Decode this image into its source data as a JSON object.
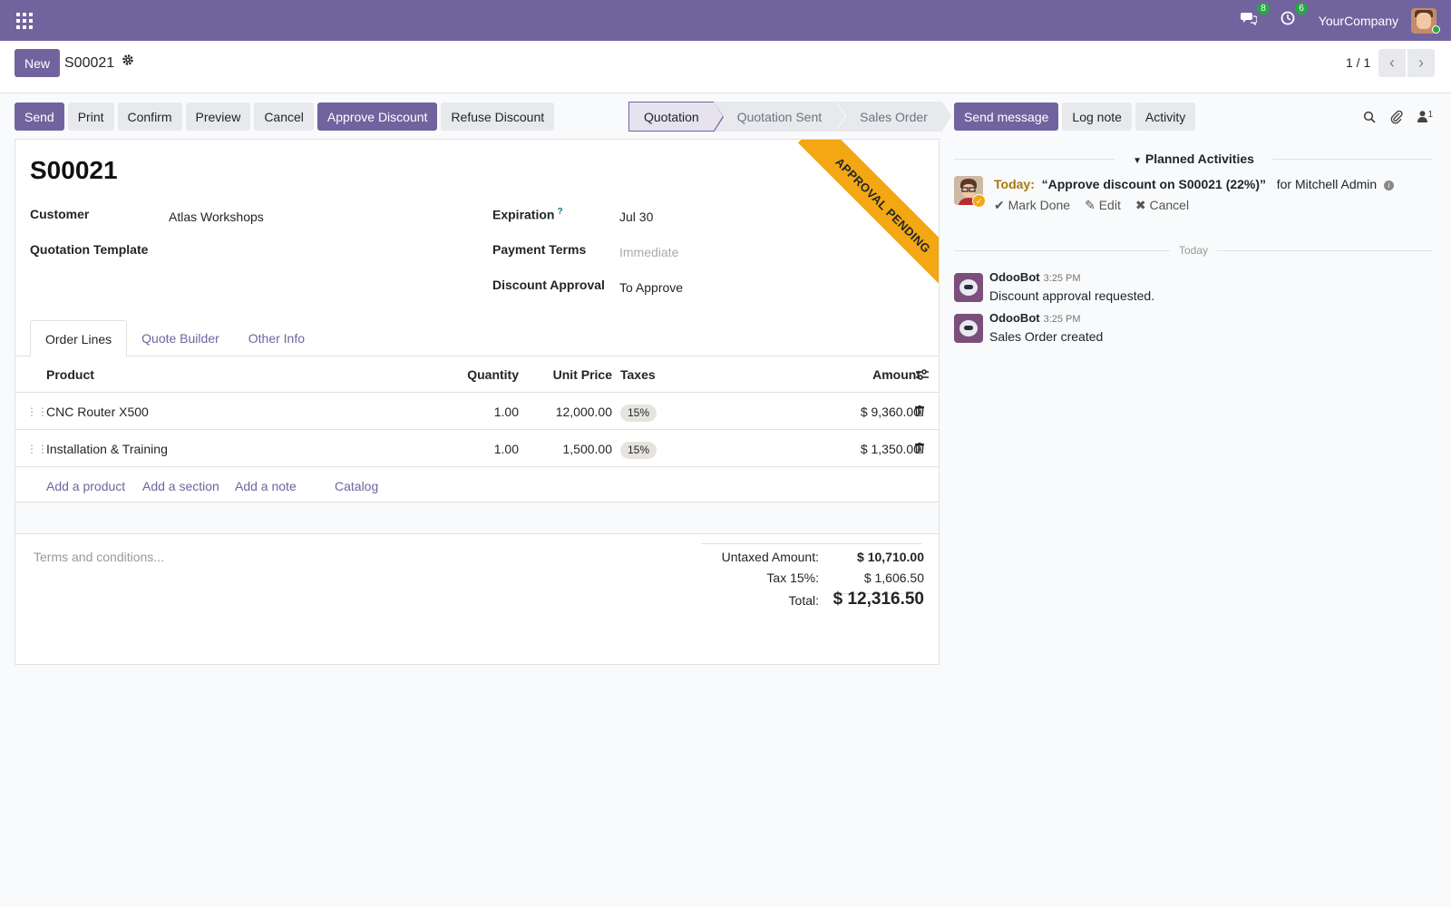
{
  "navbar": {
    "messages_badge": "8",
    "activities_badge": "6",
    "company": "YourCompany"
  },
  "control": {
    "new_label": "New",
    "record_name": "S00021",
    "pager": "1 / 1"
  },
  "actions": [
    "Send",
    "Print",
    "Confirm",
    "Preview",
    "Cancel",
    "Approve Discount",
    "Refuse Discount"
  ],
  "statusbar": [
    "Quotation",
    "Quotation Sent",
    "Sales Order"
  ],
  "form": {
    "ribbon": "APPROVAL PENDING",
    "title": "S00021",
    "customer_label": "Customer",
    "customer_value": "Atlas Workshops",
    "template_label": "Quotation Template",
    "expiration_label": "Expiration",
    "expiration_help": "?",
    "expiration_value": "Jul 30",
    "payment_terms_label": "Payment Terms",
    "payment_terms_placeholder": "Immediate",
    "discount_approval_label": "Discount Approval",
    "discount_approval_value": "To Approve",
    "tabs": [
      "Order Lines",
      "Quote Builder",
      "Other Info"
    ]
  },
  "order_lines": {
    "headers": {
      "product": "Product",
      "quantity": "Quantity",
      "unit_price": "Unit Price",
      "taxes": "Taxes",
      "amount": "Amount"
    },
    "rows": [
      {
        "product": "CNC Router X500",
        "quantity": "1.00",
        "unit_price": "12,000.00",
        "tax": "15%",
        "amount": "$ 9,360.00"
      },
      {
        "product": "Installation & Training",
        "quantity": "1.00",
        "unit_price": "1,500.00",
        "tax": "15%",
        "amount": "$ 1,350.00"
      }
    ],
    "add_links": {
      "product": "Add a product",
      "section": "Add a section",
      "note": "Add a note",
      "catalog": "Catalog"
    }
  },
  "totals": {
    "terms_placeholder": "Terms and conditions...",
    "untaxed_label": "Untaxed Amount:",
    "untaxed_value": "$ 10,710.00",
    "tax_label": "Tax 15%:",
    "tax_value": "$ 1,606.50",
    "total_label": "Total:",
    "total_value": "$ 12,316.50"
  },
  "chatter": {
    "send_message": "Send message",
    "log_note": "Log note",
    "activity": "Activity",
    "followers_count": "1",
    "planned_header": "Planned Activities",
    "activity_item": {
      "when": "Today:",
      "summary": "“Approve discount on S00021 (22%)”",
      "assignee": "for Mitchell Admin",
      "mark_done": "Mark Done",
      "edit": "Edit",
      "cancel": "Cancel"
    },
    "date_separator": "Today",
    "messages": [
      {
        "author": "OdooBot",
        "time": "3:25 PM",
        "body": "Discount approval requested."
      },
      {
        "author": "OdooBot",
        "time": "3:25 PM",
        "body": "Sales Order created"
      }
    ]
  }
}
